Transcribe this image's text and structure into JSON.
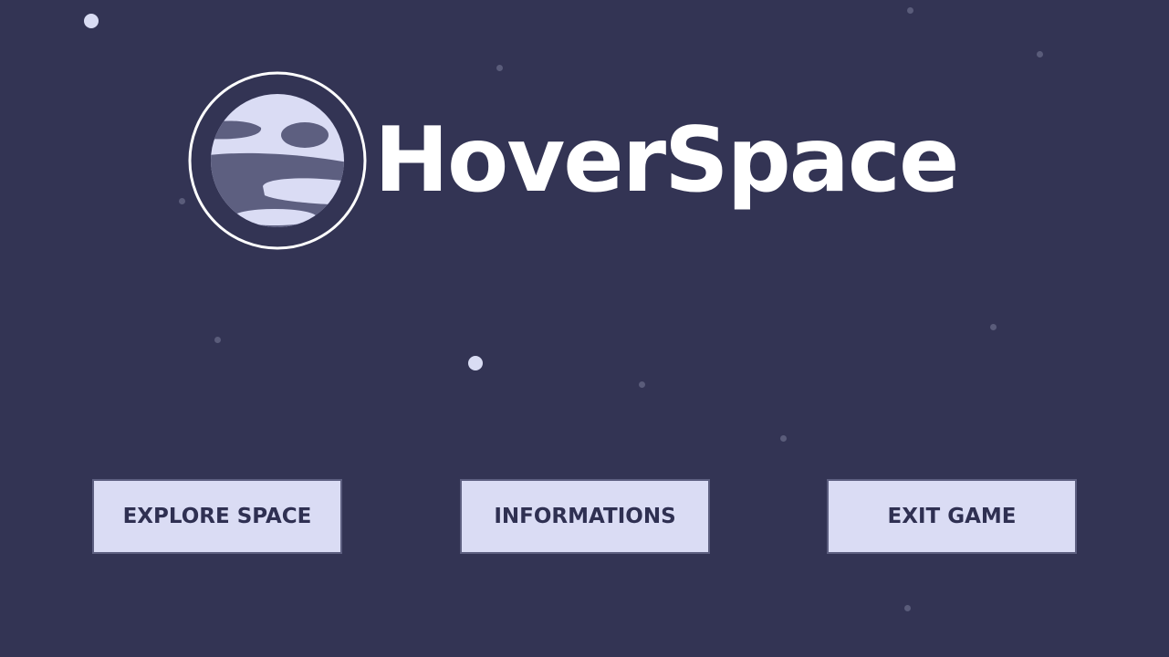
{
  "game": {
    "title": "HoverSpace"
  },
  "menu": {
    "explore_label": "EXPLORE SPACE",
    "info_label": "INFORMATIONS",
    "exit_label": "EXIT GAME"
  },
  "colors": {
    "background": "#333454",
    "button_fill": "#dadcf4",
    "button_border": "#5d5f80",
    "button_text": "#2f3052",
    "planet_light": "#dadcf4",
    "planet_dark": "#5d5f80",
    "title": "#ffffff"
  },
  "icons": {
    "logo": "planet-icon",
    "stars": "star-icon"
  }
}
